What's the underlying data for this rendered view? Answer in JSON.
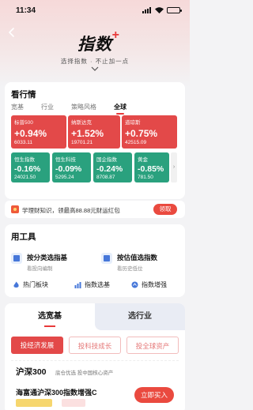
{
  "status": {
    "time": "11:34"
  },
  "header": {
    "title": "指数",
    "plus": "+",
    "slogan": "选择指数 · 不止加一点"
  },
  "market": {
    "title": "看行情",
    "tabs": [
      "宽基",
      "行业",
      "策略风格",
      "全球"
    ],
    "active_tab": "全球",
    "big_tiles": [
      {
        "name": "标普500",
        "pct": "+0.94%",
        "value": "6033.11",
        "trend": "up"
      },
      {
        "name": "纳斯达克",
        "pct": "+1.52%",
        "value": "19701.21",
        "trend": "up"
      },
      {
        "name": "道琼斯",
        "pct": "+0.75%",
        "value": "42515.09",
        "trend": "up"
      }
    ],
    "small_tiles": [
      {
        "name": "恒生指数",
        "pct": "-0.16%",
        "value": "24021.50",
        "trend": "down"
      },
      {
        "name": "恒生科技",
        "pct": "-0.09%",
        "value": "5295.24",
        "trend": "down"
      },
      {
        "name": "国企指数",
        "pct": "-0.24%",
        "value": "8708.87",
        "trend": "down"
      },
      {
        "name": "黄金",
        "pct": "-0.85%",
        "value": "781.50",
        "trend": "down"
      }
    ]
  },
  "coupon": {
    "text": "学理财知识，领最高88.88元财运红包",
    "button": "领取"
  },
  "tools": {
    "title": "用工具",
    "main": [
      {
        "title": "按分类选指基",
        "subtitle": "看投向编制"
      },
      {
        "title": "按估值选指数",
        "subtitle": "看历史低位"
      }
    ],
    "sub": [
      "热门板块",
      "指数选基",
      "指数增强"
    ]
  },
  "picker": {
    "tabs": [
      "选宽基",
      "选行业"
    ],
    "chips": [
      "投经济发展",
      "投科技成长",
      "投全球资产"
    ],
    "index_name": "沪深300",
    "index_desc": "底仓优选 投中国核心资产",
    "fund_name": "海富通沪深300指数增强C",
    "buy": "立即买入"
  },
  "colors": {
    "up": "#e34949",
    "down": "#2aa17e",
    "accent": "#ea4a3f"
  }
}
